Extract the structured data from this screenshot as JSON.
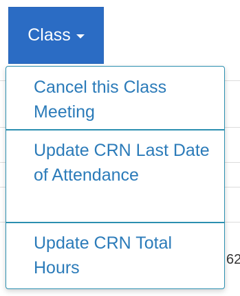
{
  "class_button": {
    "label": "Class",
    "caret_icon": "caret-down-icon",
    "background_color": "#2b6cc4"
  },
  "dropdown": {
    "items": [
      {
        "label": "Cancel this Class Meeting"
      },
      {
        "label": "Update CRN Last Date of Attendance"
      },
      {
        "label": "Update CRN Total Hours"
      }
    ],
    "link_color": "#2b7bb9",
    "border_color": "#2b8fb0"
  },
  "background": {
    "partial_cell_text": "62"
  }
}
